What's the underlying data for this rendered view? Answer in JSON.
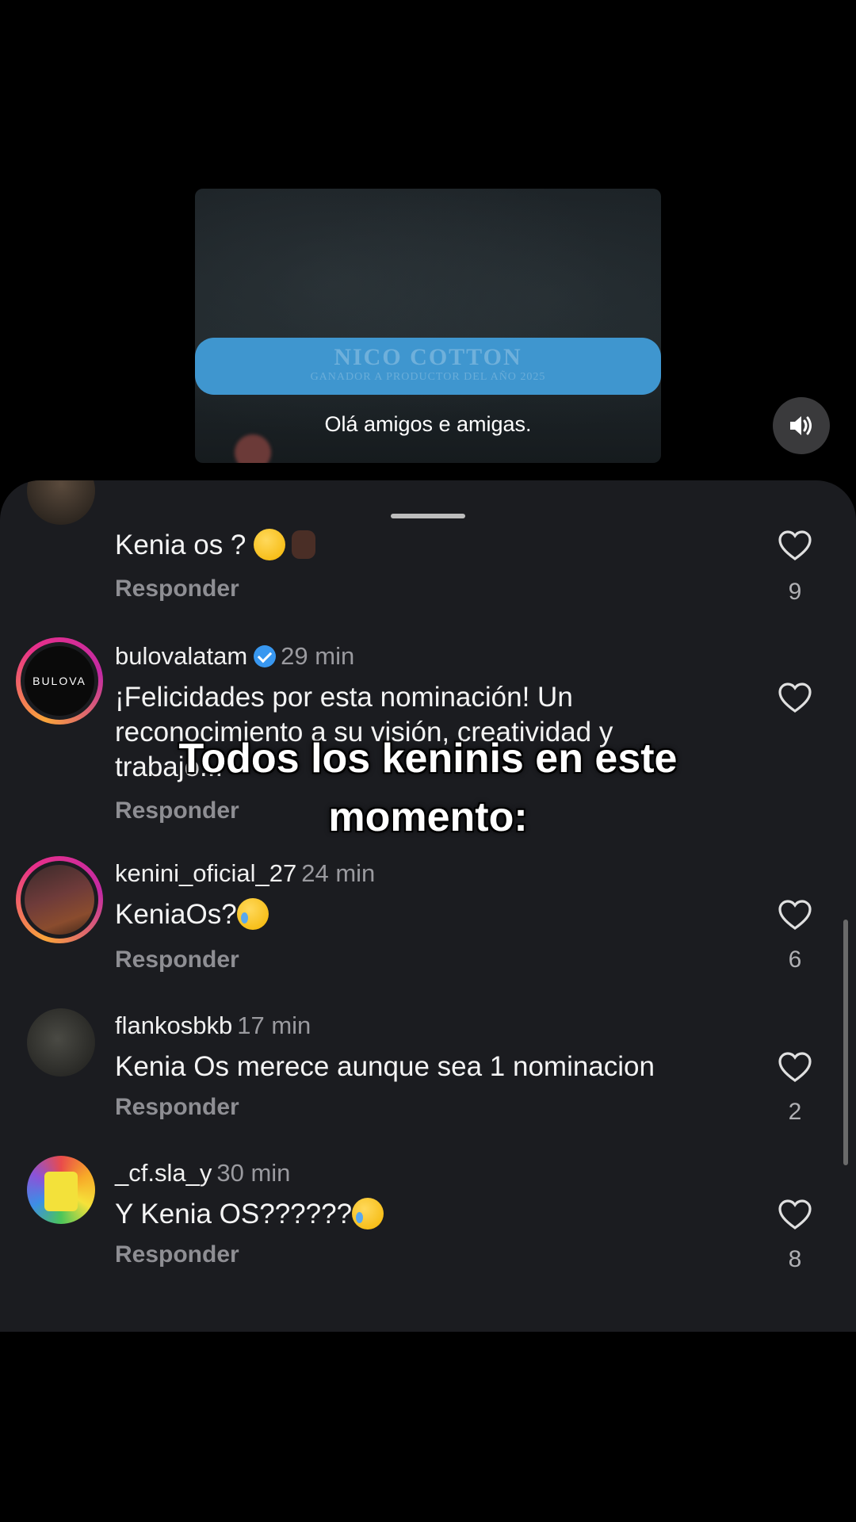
{
  "video": {
    "banner_title": "NICO COTTON",
    "banner_subtitle": "GANADOR A PRODUCTOR DEL AÑO 2025",
    "caption": "Olá amigos e amigas."
  },
  "icons": {
    "sound": "speaker-volume-icon",
    "like": "heart-outline-icon",
    "verified": "verified-badge-icon"
  },
  "overlay_text": "Todos los keninis en este momento:",
  "comments": [
    {
      "text": "Kenia os ?",
      "reply": "Responder",
      "likes": "9"
    },
    {
      "username": "bulovalatam",
      "verified": true,
      "avatar_text": "BULOVA",
      "time": "29 min",
      "text": "¡Felicidades por esta nominación! Un reconocimiento a su visión, creatividad y trabajo...",
      "reply": "Responder"
    },
    {
      "username": "kenini_oficial_27",
      "time": "24 min",
      "text": "KeniaOs?",
      "reply": "Responder",
      "likes": "6"
    },
    {
      "username": "flankosbkb",
      "time": "17 min",
      "text": "Kenia Os merece aunque sea 1 nominacion",
      "reply": "Responder",
      "likes": "2"
    },
    {
      "username": "_cf.sla_y",
      "time": "30 min",
      "text": "Y Kenia OS??????",
      "reply": "Responder",
      "likes": "8"
    }
  ],
  "colors": {
    "sheet_bg": "#1b1c20",
    "banner": "#3f96cf",
    "verified": "#3897f0",
    "story_ring_start": "#f9a43a",
    "story_ring_end": "#e8308a"
  }
}
